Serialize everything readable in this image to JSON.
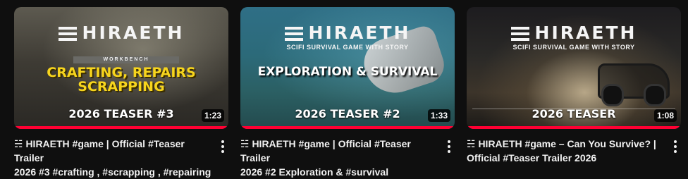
{
  "videos": [
    {
      "thumb": {
        "logo": "HIRAETH",
        "label": "WORKBENCH",
        "headline_line1": "CRAFTING, REPAIRS",
        "headline_line2": "SCRAPPING",
        "teaser": "2026 TEASER #3"
      },
      "duration": "1:23",
      "watched_fraction": 1.0,
      "title_line1": "☵ HIRAETH #game | Official #Teaser Trailer",
      "title_line2": "2026 #3 #crafting , #scrapping , #repairing"
    },
    {
      "thumb": {
        "logo": "HIRAETH",
        "subtitle": "SCIFI SURVIVAL GAME WITH STORY",
        "headline_line1": "EXPLORATION & SURVIVAL",
        "teaser": "2026 TEASER #2"
      },
      "duration": "1:33",
      "watched_fraction": 1.0,
      "title_line1": "☵ HIRAETH #game | Official #Teaser Trailer",
      "title_line2": "2026 #2 Exploration & #survival"
    },
    {
      "thumb": {
        "logo": "HIRAETH",
        "subtitle": "SCIFI SURVIVAL GAME WITH STORY",
        "teaser": "2026 TEASER"
      },
      "duration": "1:08",
      "watched_fraction": 1.0,
      "title_line1": "☵ HIRAETH #game – Can You Survive? |",
      "title_line2": "Official #Teaser Trailer 2026"
    }
  ],
  "colors": {
    "background": "#0f0f0f",
    "progress": "#ff0033",
    "accent_yellow": "#f7d51d"
  },
  "icons": [
    "more-vert-icon"
  ]
}
